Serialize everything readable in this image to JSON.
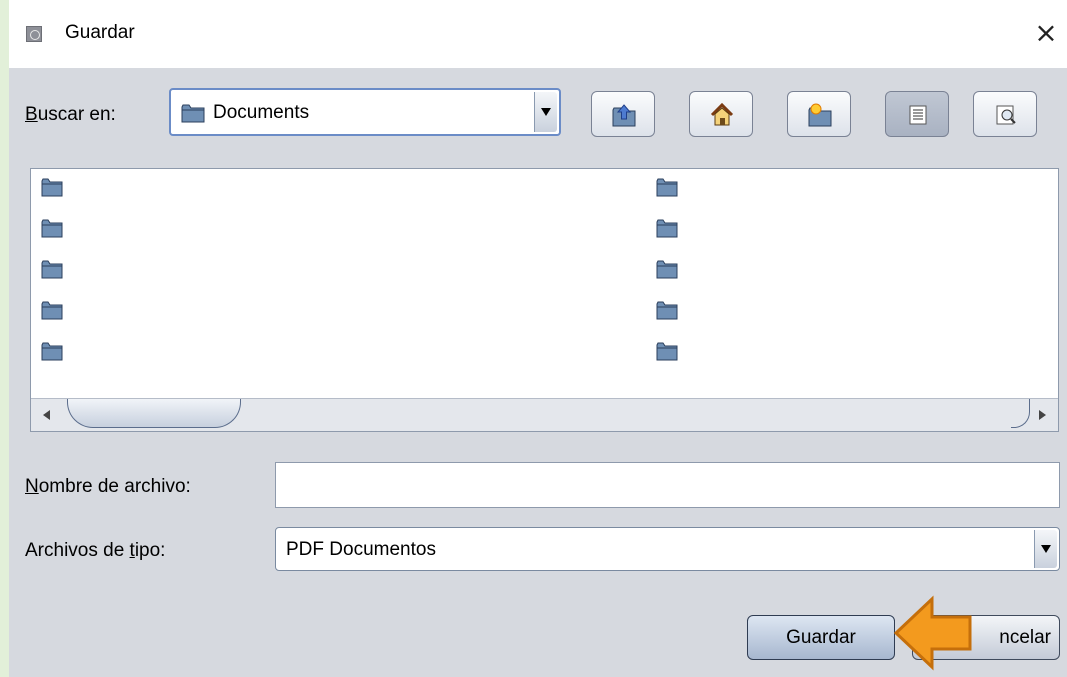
{
  "window": {
    "title": "Guardar",
    "close_glyph": "×",
    "app_icon": "java-app-icon"
  },
  "lookin": {
    "label_prefix": "",
    "label_mnemonic": "B",
    "label_rest": "uscar en:",
    "value": "Documents"
  },
  "toolbar": {
    "buttons": [
      {
        "name": "up-one-level",
        "icon": "folder-up-icon"
      },
      {
        "name": "home",
        "icon": "home-icon"
      },
      {
        "name": "new-folder",
        "icon": "new-folder-icon"
      },
      {
        "name": "list-view",
        "icon": "list-view-icon"
      },
      {
        "name": "details-view",
        "icon": "details-view-icon"
      }
    ]
  },
  "filelist": {
    "folders_per_column": 5,
    "columns": 2,
    "item_icon": "folder-icon"
  },
  "filename": {
    "label_mnemonic": "N",
    "label_rest": "ombre de archivo:",
    "value": ""
  },
  "filetype": {
    "label_prefix": "Archivos de ",
    "label_mnemonic": "t",
    "label_rest": "ipo:",
    "value": "PDF Documentos"
  },
  "buttons": {
    "save": "Guardar",
    "cancel_visible": "ncelar"
  },
  "colors": {
    "pointer": "#f39a1e",
    "pointer_border": "#c56f0b"
  }
}
